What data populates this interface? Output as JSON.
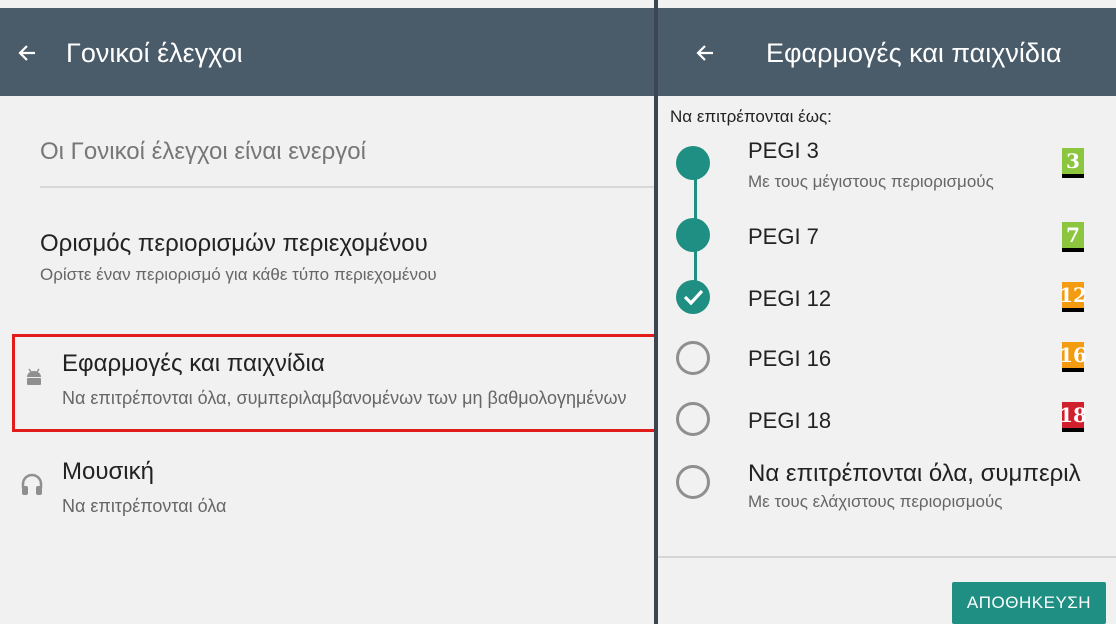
{
  "left_panel": {
    "header": {
      "title": "Γονικοί έλεγχοι",
      "back_icon": "arrow-left-icon"
    },
    "status_text": "Οι Γονικοί έλεγχοι είναι ενεργοί",
    "section": {
      "title": "Ορισμός περιορισμών περιεχομένου",
      "subtitle": "Ορίστε έναν περιορισμό για κάθε τύπο περιεχομένου"
    },
    "items": [
      {
        "icon": "android-icon",
        "title": "Εφαρμογές και παιχνίδια",
        "subtitle": "Να επιτρέπονται όλα, συμπεριλαμβανομένων των μη βαθμολογημένων"
      },
      {
        "icon": "headphones-icon",
        "title": "Μουσική",
        "subtitle": "Να επιτρέπονται όλα"
      }
    ],
    "highlight_color": "#e21b1b"
  },
  "right_panel": {
    "header": {
      "title": "Εφαρμογές και παιχνίδια",
      "back_icon": "arrow-left-icon"
    },
    "allowed_label": "Να επιτρέπονται έως:",
    "options": [
      {
        "label": "PEGI 3",
        "sublabel": "Με τους μέγιστους περιορισμούς",
        "badge": "3",
        "badge_color": "#8cc63f",
        "state": "filled"
      },
      {
        "label": "PEGI 7",
        "sublabel": "",
        "badge": "7",
        "badge_color": "#8cc63f",
        "state": "filled"
      },
      {
        "label": "PEGI 12",
        "sublabel": "",
        "badge": "12",
        "badge_color": "#f39c12",
        "state": "selected"
      },
      {
        "label": "PEGI 16",
        "sublabel": "",
        "badge": "16",
        "badge_color": "#f39c12",
        "state": "empty"
      },
      {
        "label": "PEGI 18",
        "sublabel": "",
        "badge": "18",
        "badge_color": "#d0202e",
        "state": "empty"
      },
      {
        "label": "Να επιτρέπονται όλα, συμπεριλ",
        "sublabel": "Με τους ελάχιστους περιορισμούς",
        "badge": "",
        "badge_color": "",
        "state": "empty"
      }
    ],
    "save_button": "ΑΠΟΘΗΚΕΥΣΗ"
  },
  "colors": {
    "app_bar": "#4a5b69",
    "accent": "#1e8f82",
    "background": "#f1f1f1"
  }
}
